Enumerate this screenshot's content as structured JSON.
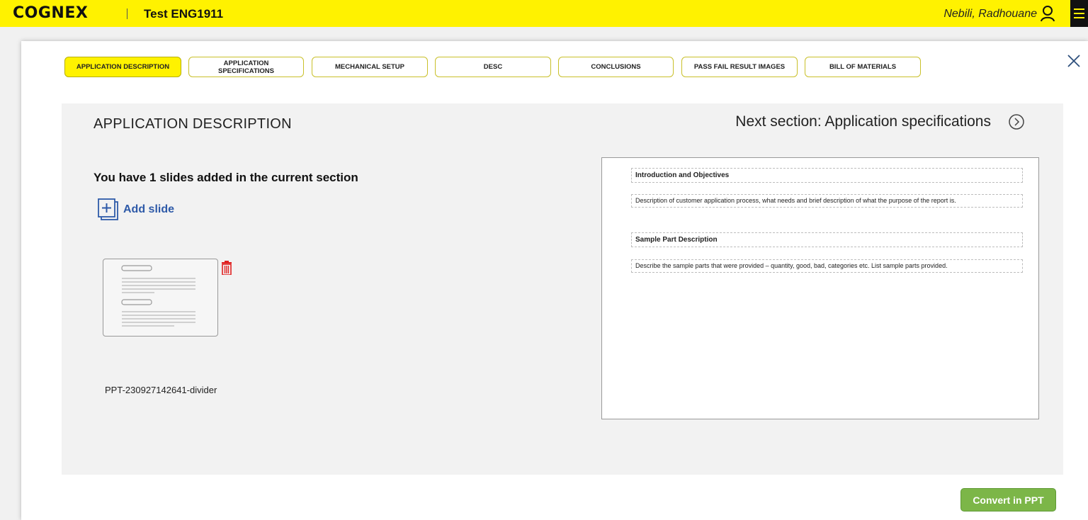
{
  "header": {
    "logo_text": "COGNEX",
    "project_title": "Test ENG1911",
    "user_name": "Nebili, Radhouane",
    "accent_color": "#fff200"
  },
  "tabs": [
    {
      "label": "APPLICATION DESCRIPTION",
      "active": true
    },
    {
      "label": "APPLICATION SPECIFICATIONS",
      "active": false
    },
    {
      "label": "MECHANICAL SETUP",
      "active": false
    },
    {
      "label": "DESC",
      "active": false
    },
    {
      "label": "CONCLUSIONS",
      "active": false
    },
    {
      "label": "PASS FAIL RESULT IMAGES",
      "active": false
    },
    {
      "label": "BILL OF MATERIALS",
      "active": false
    }
  ],
  "section": {
    "title": "APPLICATION DESCRIPTION",
    "next_label": "Next section: Application specifications",
    "slides_count_text": "You have 1 slides added in the current section",
    "add_slide_label": "Add slide",
    "slide_name": "PPT-230927142641-divider"
  },
  "preview": {
    "blocks": [
      {
        "type": "heading",
        "text": "Introduction and Objectives"
      },
      {
        "type": "text",
        "text": "Description of customer application process, what needs and brief description of what the purpose of the report is."
      },
      {
        "type": "heading",
        "text": "Sample Part Description"
      },
      {
        "type": "text",
        "text": "Describe the sample parts that were provided – quantity, good, bad, categories etc. List sample parts provided."
      }
    ]
  },
  "actions": {
    "convert_label": "Convert in PPT"
  },
  "icons": {
    "user": "user-icon",
    "menu": "hamburger-menu-icon",
    "close": "close-icon",
    "next": "chevron-right-circle-icon",
    "add": "add-slide-icon",
    "delete": "trash-icon"
  }
}
